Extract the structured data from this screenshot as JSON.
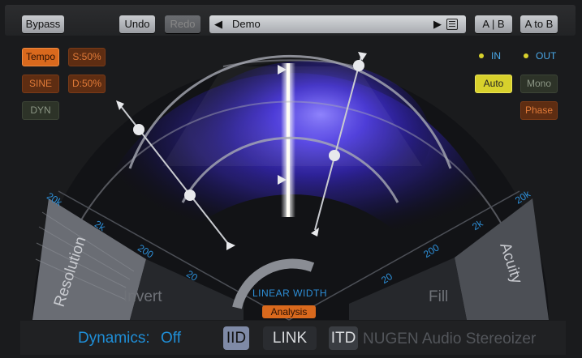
{
  "toolbar": {
    "bypass": "Bypass",
    "undo": "Undo",
    "redo": "Redo",
    "preset_name": "Demo",
    "prev_arrow": "◀",
    "next_arrow": "▶",
    "ab": "A | B",
    "a_to_b": "A to B"
  },
  "left_buttons": {
    "tempo": "Tempo",
    "sync": "S:50%",
    "sine": "SINE",
    "depth": "D:50%",
    "dyn": "DYN"
  },
  "right_panel": {
    "in": "IN",
    "out": "OUT",
    "auto": "Auto",
    "mono": "Mono",
    "phase": "Phase"
  },
  "scale": {
    "left": [
      "20k",
      "2k",
      "200",
      "20"
    ],
    "right": [
      "20k",
      "2k",
      "200",
      "20"
    ]
  },
  "labels": {
    "resolution": "Resolution",
    "invert": "Invert",
    "fill": "Fill",
    "acuity": "Acuity"
  },
  "meter": {
    "linear_width": "LINEAR WIDTH",
    "analysis": "Analysis"
  },
  "bottom": {
    "dynamics_label": "Dynamics:",
    "dynamics_value": "Off",
    "iid": "IID",
    "link": "LINK",
    "itd": "ITD",
    "brand": "NUGEN Audio Stereoizer"
  },
  "colors": {
    "accent_blue": "#1f8fd8",
    "orange": "#d9691d",
    "yellow": "#d8d12c",
    "spectrum": "#3b2bd8"
  }
}
